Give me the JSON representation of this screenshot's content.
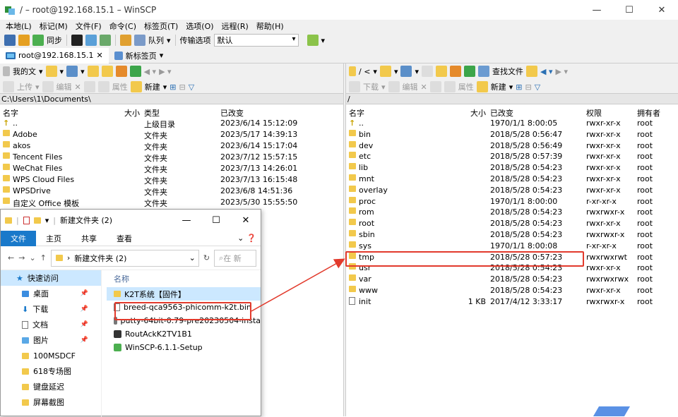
{
  "window": {
    "title": "/ – root@192.168.15.1 – WinSCP"
  },
  "menu": [
    "本地(L)",
    "标记(M)",
    "文件(F)",
    "命令(C)",
    "标签页(T)",
    "选项(O)",
    "远程(R)",
    "帮助(H)"
  ],
  "toolbar": {
    "sync": "同步",
    "queue": "队列",
    "transfer_label": "传输选项",
    "transfer_value": "默认"
  },
  "tabs": [
    {
      "label": "root@192.168.15.1"
    },
    {
      "label": "新标签页"
    }
  ],
  "local": {
    "location": "我的文",
    "toolbar": {
      "upload": "上传",
      "edit": "编辑",
      "props": "属性",
      "new": "新建"
    },
    "path": "C:\\Users\\1\\Documents\\",
    "headers": {
      "name": "名字",
      "size": "大小",
      "type": "类型",
      "changed": "已改变"
    },
    "rows": [
      {
        "name": "..",
        "size": "",
        "type": "上级目录",
        "changed": "2023/6/14 15:12:09"
      },
      {
        "name": "Adobe",
        "size": "",
        "type": "文件夹",
        "changed": "2023/5/17 14:39:13"
      },
      {
        "name": "akos",
        "size": "",
        "type": "文件夹",
        "changed": "2023/6/14 15:17:04"
      },
      {
        "name": "Tencent Files",
        "size": "",
        "type": "文件夹",
        "changed": "2023/7/12 15:57:15"
      },
      {
        "name": "WeChat Files",
        "size": "",
        "type": "文件夹",
        "changed": "2023/7/13 14:26:01"
      },
      {
        "name": "WPS Cloud Files",
        "size": "",
        "type": "文件夹",
        "changed": "2023/7/13 16:15:48"
      },
      {
        "name": "WPSDrive",
        "size": "",
        "type": "文件夹",
        "changed": "2023/6/8 14:51:36"
      },
      {
        "name": "自定义 Office 模板",
        "size": "",
        "type": "文件夹",
        "changed": "2023/5/30 15:55:50"
      }
    ]
  },
  "remote": {
    "location": "/ <",
    "find": "查找文件",
    "toolbar": {
      "download": "下载",
      "edit": "编辑",
      "props": "属性",
      "new": "新建"
    },
    "path": "/",
    "headers": {
      "name": "名字",
      "size": "大小",
      "changed": "已改变",
      "rights": "权限",
      "owner": "拥有者"
    },
    "rows": [
      {
        "name": "..",
        "size": "",
        "changed": "1970/1/1 8:00:05",
        "rights": "rwxr-xr-x",
        "owner": "root"
      },
      {
        "name": "bin",
        "size": "",
        "changed": "2018/5/28 0:56:47",
        "rights": "rwxr-xr-x",
        "owner": "root"
      },
      {
        "name": "dev",
        "size": "",
        "changed": "2018/5/28 0:56:49",
        "rights": "rwxr-xr-x",
        "owner": "root"
      },
      {
        "name": "etc",
        "size": "",
        "changed": "2018/5/28 0:57:39",
        "rights": "rwxr-xr-x",
        "owner": "root"
      },
      {
        "name": "lib",
        "size": "",
        "changed": "2018/5/28 0:54:23",
        "rights": "rwxr-xr-x",
        "owner": "root"
      },
      {
        "name": "mnt",
        "size": "",
        "changed": "2018/5/28 0:54:23",
        "rights": "rwxr-xr-x",
        "owner": "root"
      },
      {
        "name": "overlay",
        "size": "",
        "changed": "2018/5/28 0:54:23",
        "rights": "rwxr-xr-x",
        "owner": "root"
      },
      {
        "name": "proc",
        "size": "",
        "changed": "1970/1/1 8:00:00",
        "rights": "r-xr-xr-x",
        "owner": "root"
      },
      {
        "name": "rom",
        "size": "",
        "changed": "2018/5/28 0:54:23",
        "rights": "rwxrwxr-x",
        "owner": "root"
      },
      {
        "name": "root",
        "size": "",
        "changed": "2018/5/28 0:54:23",
        "rights": "rwxr-xr-x",
        "owner": "root"
      },
      {
        "name": "sbin",
        "size": "",
        "changed": "2018/5/28 0:54:23",
        "rights": "rwxrwxr-x",
        "owner": "root"
      },
      {
        "name": "sys",
        "size": "",
        "changed": "1970/1/1 8:00:08",
        "rights": "r-xr-xr-x",
        "owner": "root"
      },
      {
        "name": "tmp",
        "size": "",
        "changed": "2018/5/28 0:57:23",
        "rights": "rwxrwxrwt",
        "owner": "root"
      },
      {
        "name": "usr",
        "size": "",
        "changed": "2018/5/28 0:54:23",
        "rights": "rwxr-xr-x",
        "owner": "root"
      },
      {
        "name": "var",
        "size": "",
        "changed": "2018/5/28 0:54:23",
        "rights": "rwxrwxrwx",
        "owner": "root"
      },
      {
        "name": "www",
        "size": "",
        "changed": "2018/5/28 0:54:23",
        "rights": "rwxr-xr-x",
        "owner": "root"
      },
      {
        "name": "init",
        "size": "1 KB",
        "changed": "2017/4/12 3:33:17",
        "rights": "rwxrwxr-x",
        "owner": "root"
      }
    ]
  },
  "explorer": {
    "title": "新建文件夹 (2)",
    "ribbon": [
      "文件",
      "主页",
      "共享",
      "查看"
    ],
    "address": "新建文件夹 (2)",
    "search_placeholder": "在 新",
    "nav": [
      {
        "label": "快速访问"
      },
      {
        "label": "桌面"
      },
      {
        "label": "下载"
      },
      {
        "label": "文档"
      },
      {
        "label": "图片"
      },
      {
        "label": "100MSDCF"
      },
      {
        "label": "618专场图"
      },
      {
        "label": "键盘延迟"
      },
      {
        "label": "屏幕截图"
      }
    ],
    "column": "名称",
    "items": [
      {
        "name": "K2T系统【固件】"
      },
      {
        "name": "breed-qca9563-phicomm-k2t.bin"
      },
      {
        "name": "putty-64bit-0.79-pre20230504-insta"
      },
      {
        "name": "RoutAckK2TV1B1"
      },
      {
        "name": "WinSCP-6.1.1-Setup"
      }
    ]
  },
  "colors": {
    "accent": "#1979ca",
    "highlight": "#e23a2c",
    "folder": "#f2c94c"
  }
}
